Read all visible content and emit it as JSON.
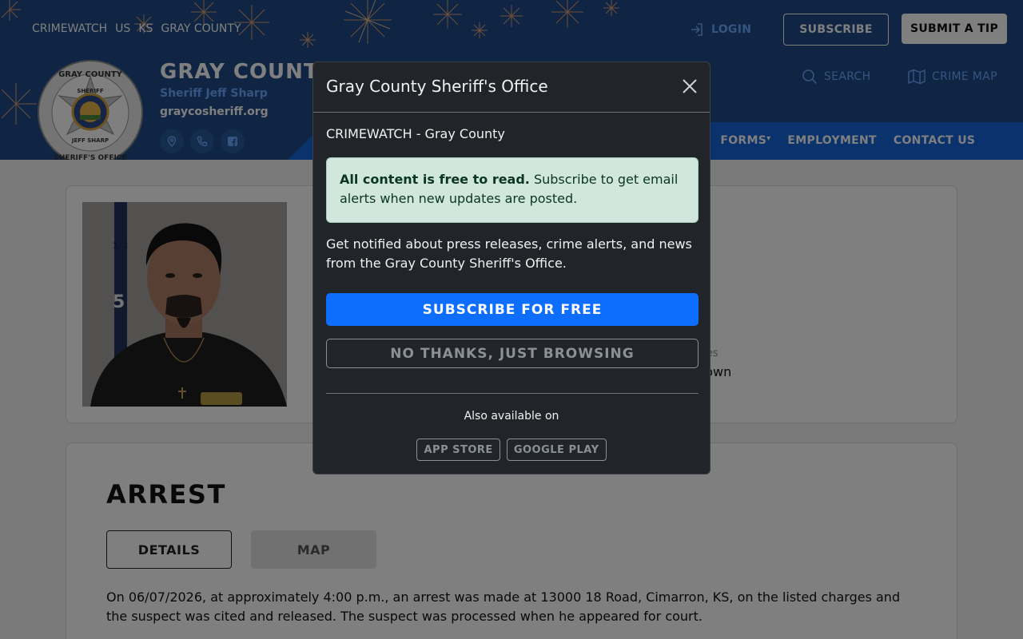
{
  "breadcrumb": [
    "CRIMEWATCH",
    "US",
    "KS",
    "GRAY COUNTY"
  ],
  "top_actions": {
    "login": "LOGIN",
    "subscribe": "SUBSCRIBE",
    "submit_tip": "SUBMIT A TIP"
  },
  "agency": {
    "name": "GRAY COUNTY",
    "sheriff": "Sheriff Jeff Sharp",
    "website": "graycosheriff.org",
    "badge_text_top": "GRAY COUNTY",
    "badge_text_bottom": "SHERIFF'S OFFICE",
    "badge_sheriff": "SHERIFF",
    "badge_name": "JEFF SHARP"
  },
  "tools": {
    "search": "SEARCH",
    "crime_map": "CRIME MAP"
  },
  "nav": {
    "items": [
      "FORMS",
      "EMPLOYMENT",
      "CONTACT US"
    ]
  },
  "profile": {
    "eyes_label": "yes",
    "eyes_value": "rown"
  },
  "post": {
    "title": "ARREST",
    "tabs": [
      "DETAILS",
      "MAP"
    ],
    "body": "On 06/07/2026, at approximately 4:00 p.m., an arrest was made at 13000 18 Road, Cimarron, KS, on the listed charges and the suspect was cited and released.  The suspect was processed when he appeared for court."
  },
  "modal": {
    "title": "Gray County Sheriff's Office",
    "subtitle": "CRIMEWATCH - Gray County",
    "alert_bold": "All content is free to read.",
    "alert_rest": " Subscribe to get email alerts when new updates are posted.",
    "description": "Get notified about press releases, crime alerts, and news from the Gray County Sheriff's Office.",
    "primary": "SUBSCRIBE FOR FREE",
    "secondary": "NO THANKS, JUST BROWSING",
    "also": "Also available on",
    "stores": [
      "APP STORE",
      "GOOGLE PLAY"
    ]
  },
  "colors": {
    "header_bg": "#1f4a86",
    "nav_bg": "#1565d8",
    "link_blue": "#6aa8ff",
    "modal_bg": "#212529",
    "primary_btn": "#0d6efd",
    "alert_bg": "#d1e7dd"
  }
}
